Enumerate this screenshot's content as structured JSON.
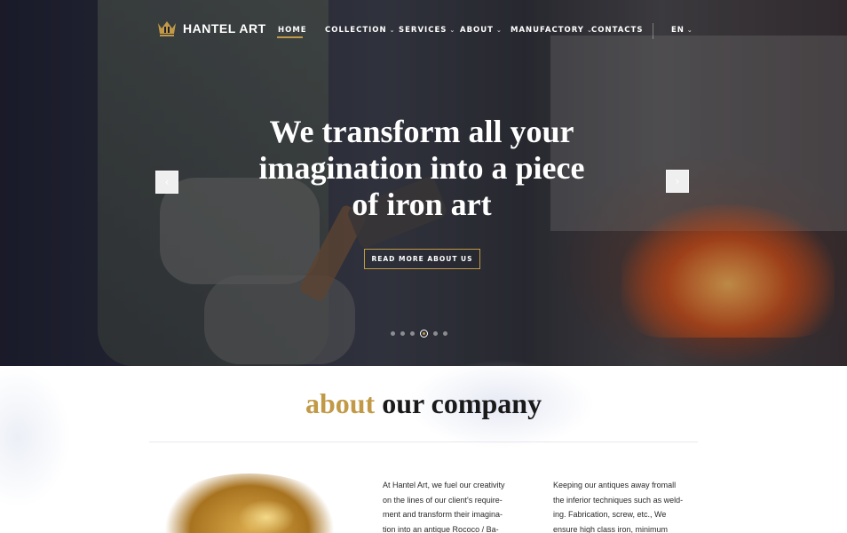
{
  "brand": {
    "name": "HANTEL ART",
    "accent_color": "#c29a47"
  },
  "nav": {
    "items": [
      {
        "label": "HOME",
        "has_dropdown": false,
        "active": true
      },
      {
        "label": "COLLECTION",
        "has_dropdown": true
      },
      {
        "label": "SERVICES",
        "has_dropdown": true
      },
      {
        "label": "ABOUT",
        "has_dropdown": true
      },
      {
        "label": "MANUFACTORY",
        "has_dropdown": true
      },
      {
        "label": "CONTACTS",
        "has_dropdown": false
      }
    ],
    "language": "EN"
  },
  "hero": {
    "headline_lines": [
      "We transform all your",
      "imagination into a piece",
      "of iron art"
    ],
    "button_label": "READ MORE ABOUT US",
    "prev_icon": "chevron-left-icon",
    "next_icon": "chevron-right-icon",
    "slides_count": 6,
    "active_slide": 4
  },
  "about": {
    "title_accent": "about",
    "title_rest": "our company",
    "col1_lines": [
      "At Hantel Art, we fuel our creativity",
      "on the lines of our client's require-",
      "ment and transform their imagina-",
      "tion into an antique Rococo / Ba-"
    ],
    "col2_lines": [
      "Keeping our antiques away fromall",
      "the inferior techniques such as weld-",
      "ing. Fabrication, screw, etc., We",
      "ensure high class iron, minimum"
    ]
  }
}
